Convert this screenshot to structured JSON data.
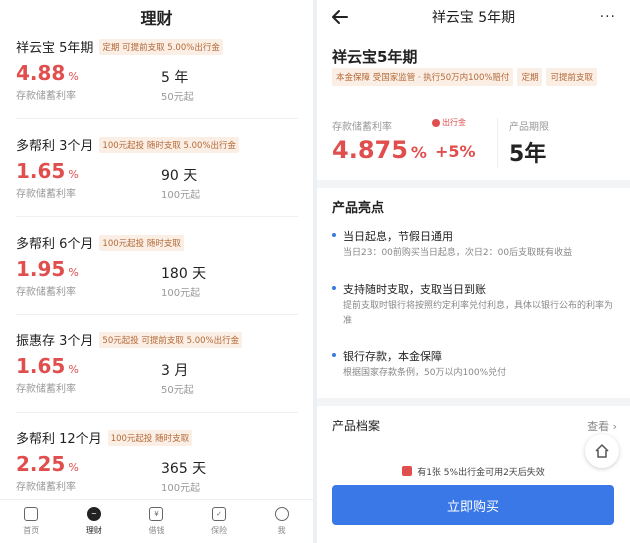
{
  "left": {
    "title": "理财",
    "products": [
      {
        "name": "祥云宝 5年期",
        "tag": "定期  可提前支取 5.00%出行金",
        "rate": "4.88",
        "pct": "%",
        "rate_label": "存款储蓄利率",
        "term": "5 年",
        "min": "50元起"
      },
      {
        "name": "多帮利 3个月",
        "tag": "100元起投  随时支取 5.00%出行金",
        "rate": "1.65",
        "pct": "%",
        "rate_label": "存款储蓄利率",
        "term": "90 天",
        "min": "100元起"
      },
      {
        "name": "多帮利 6个月",
        "tag": "100元起投  随时支取",
        "rate": "1.95",
        "pct": "%",
        "rate_label": "存款储蓄利率",
        "term": "180 天",
        "min": "100元起"
      },
      {
        "name": "振惠存 3个月",
        "tag": "50元起投  可提前支取 5.00%出行金",
        "rate": "1.65",
        "pct": "%",
        "rate_label": "存款储蓄利率",
        "term": "3 月",
        "min": "50元起"
      },
      {
        "name": "多帮利 12个月",
        "tag": "100元起投  随时支取",
        "rate": "2.25",
        "pct": "%",
        "rate_label": "存款储蓄利率",
        "term": "365 天",
        "min": "100元起"
      }
    ],
    "tabs": [
      {
        "label": "首页",
        "glyph": ""
      },
      {
        "label": "理财",
        "glyph": "~"
      },
      {
        "label": "借钱",
        "glyph": "¥"
      },
      {
        "label": "保险",
        "glyph": "✓"
      },
      {
        "label": "我",
        "glyph": ""
      }
    ]
  },
  "right": {
    "header_title": "祥云宝 5年期",
    "more": "···",
    "product_title": "祥云宝5年期",
    "tags": [
      "本金保障  受国家监管 · 执行50万内100%赔付",
      "定期",
      "可提前支取"
    ],
    "rate_label": "存款储蓄利率",
    "rate": "4.875",
    "pct": "%",
    "bonus_tag": "出行金",
    "bonus": "+5%",
    "term_label": "产品期限",
    "term": "5年",
    "highlights_title": "产品亮点",
    "highlights": [
      {
        "title": "当日起息，节假日通用",
        "desc": "当日23：00前购买当日起息，次日2：00后支取既有收益"
      },
      {
        "title": "支持随时支取，支取当日到账",
        "desc": "提前支取时银行将按照约定利率兑付利息，具体以银行公布的利率为准"
      },
      {
        "title": "银行存款，本金保障",
        "desc": "根据国家存款条例，50万以内100%兑付"
      }
    ],
    "archive_label": "产品档案",
    "archive_more": "查看 ›",
    "coupon_text": "有1张 5%出行金可用2天后失效",
    "buy_label": "立即购买"
  }
}
